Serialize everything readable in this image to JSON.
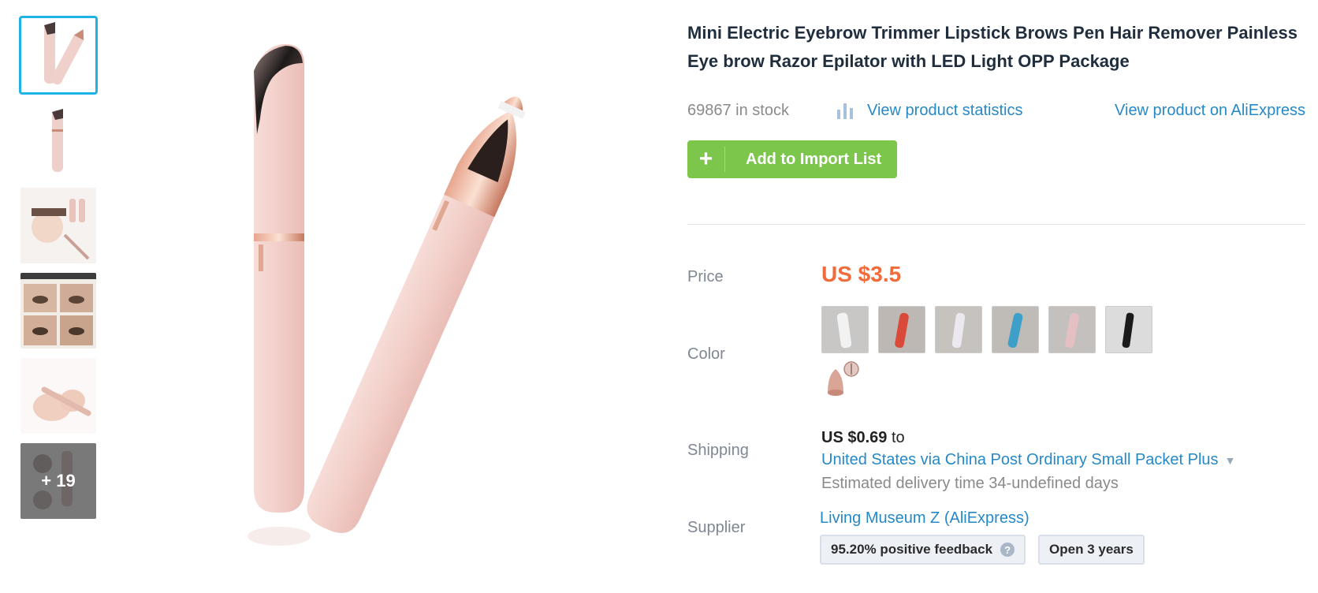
{
  "thumbnails": {
    "more_count": "+ 19"
  },
  "product": {
    "title": "Mini Electric Eyebrow Trimmer Lipstick Brows Pen Hair Remover Painless Eye brow Razor Epilator with LED Light OPP Package",
    "stock": "69867 in stock",
    "stats_link": "View product statistics",
    "ali_link": "View product on AliExpress",
    "import_button": "Add to Import List",
    "import_icon": "+"
  },
  "labels": {
    "price": "Price",
    "color": "Color",
    "shipping": "Shipping",
    "supplier": "Supplier"
  },
  "price": "US $3.5",
  "colors": [
    {
      "name": "silver",
      "hex": "#d9d9d9"
    },
    {
      "name": "red",
      "hex": "#d94a3a"
    },
    {
      "name": "gray",
      "hex": "#b8b2bd"
    },
    {
      "name": "blue",
      "hex": "#3ea0c9"
    },
    {
      "name": "pink",
      "hex": "#e4bfc4"
    },
    {
      "name": "black",
      "hex": "#1b1b1b"
    }
  ],
  "shipping": {
    "cost": "US $0.69",
    "cost_suffix": "to",
    "route": "United States via China Post Ordinary Small Packet Plus",
    "estimate": "Estimated delivery time 34-undefined days"
  },
  "supplier": {
    "name": "Living Museum Z (AliExpress)",
    "feedback": "95.20% positive feedback",
    "feedback_help": "?",
    "open": "Open 3 years"
  },
  "theme": {
    "accent_link": "#2589c8",
    "price_color": "#f26b3a",
    "button_green": "#7bc64b",
    "thumb_active": "#22b3e6"
  }
}
